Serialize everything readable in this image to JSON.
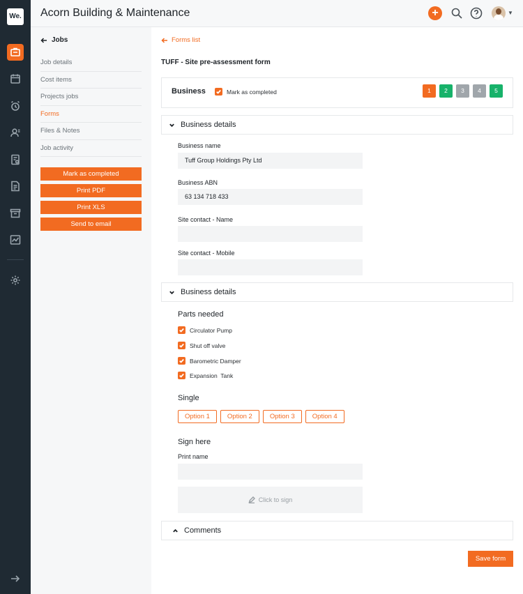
{
  "app": {
    "logo": "We.",
    "title": "Acorn Building & Maintenance"
  },
  "topbar": {
    "icons": [
      "plus-icon",
      "search-icon",
      "help-icon",
      "avatar"
    ]
  },
  "rail": {
    "icons": [
      "jobs-icon",
      "calendar-icon",
      "alarm-icon",
      "contacts-icon",
      "reports-icon",
      "documents-icon",
      "archive-icon",
      "analytics-icon",
      "settings-icon",
      "expand-icon"
    ],
    "active": "jobs-icon"
  },
  "sidenav": {
    "back_label": "Jobs",
    "items": [
      {
        "label": "Job details",
        "active": false
      },
      {
        "label": "Cost items",
        "active": false
      },
      {
        "label": "Projects jobs",
        "active": false
      },
      {
        "label": "Forms",
        "active": true
      },
      {
        "label": "Files & Notes",
        "active": false
      },
      {
        "label": "Job activity",
        "active": false
      }
    ],
    "actions": [
      "Mark as completed",
      "Print PDF",
      "Print XLS",
      "Send to email"
    ]
  },
  "main": {
    "back_label": "Forms list",
    "form_title": "TUFF - Site pre-assessment form",
    "business_card": {
      "label": "Business",
      "mark_completed": "Mark as completed",
      "steps": [
        {
          "label": "1",
          "color": "#f26b21"
        },
        {
          "label": "2",
          "color": "#17b26a"
        },
        {
          "label": "3",
          "color": "#a0a6ab"
        },
        {
          "label": "4",
          "color": "#a0a6ab"
        },
        {
          "label": "5",
          "color": "#17b26a"
        }
      ]
    },
    "section1": {
      "title": "Business details",
      "fields": [
        {
          "label": "Business name",
          "value": "Tuff Group Holdings Pty Ltd"
        },
        {
          "label": "Business ABN",
          "value": "63 134 718 433"
        },
        {
          "label": "Site contact - Name",
          "value": ""
        },
        {
          "label": "Site contact - Mobile",
          "value": ""
        }
      ]
    },
    "section2": {
      "title": "Business details",
      "parts_title": "Parts needed",
      "parts": [
        "Circulator Pump",
        "Shut off valve",
        "Barometric Damper",
        "Expansion  Tank"
      ],
      "single_title": "Single",
      "options": [
        "Option 1",
        "Option 2",
        "Option 3",
        "Option 4"
      ],
      "sign_title": "Sign here",
      "print_name_label": "Print name",
      "print_name_value": "",
      "sign_placeholder": "Click to sign"
    },
    "comments": {
      "title": "Comments"
    },
    "save_label": "Save form"
  }
}
